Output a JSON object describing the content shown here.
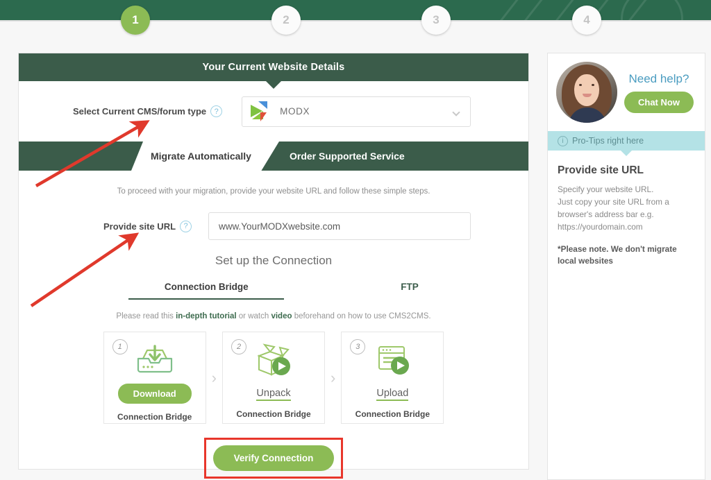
{
  "stepper": {
    "steps": [
      {
        "label": "1",
        "state": "active"
      },
      {
        "label": "2",
        "state": "idle"
      },
      {
        "label": "3",
        "state": "idle"
      },
      {
        "label": "4",
        "state": "idle"
      }
    ]
  },
  "main": {
    "header_title": "Your Current Website Details",
    "cms_field": {
      "label": "Select Current CMS/forum type",
      "help_icon": "question-icon",
      "selected": "MODX",
      "chevron": "chevron-down-icon"
    },
    "tabs": [
      {
        "label": "Migrate Automatically",
        "active": true
      },
      {
        "label": "Order Supported Service",
        "active": false
      }
    ],
    "intro_text": "To proceed with your migration, provide your website URL and follow these simple steps.",
    "url_field": {
      "label": "Provide site URL",
      "help_icon": "question-icon",
      "value": "www.YourMODXwebsite.com",
      "placeholder": "www.YourMODXwebsite.com"
    },
    "setup_title": "Set up the Connection",
    "connection_tabs": [
      {
        "label": "Connection Bridge",
        "active": true
      },
      {
        "label": "FTP",
        "active": false
      }
    ],
    "read_line": {
      "prefix": "Please read this ",
      "link1": "in-depth tutorial",
      "middle": " or watch ",
      "link2": "video",
      "suffix": " beforehand on how to use CMS2CMS."
    },
    "bridge_steps": [
      {
        "num": "1",
        "icon": "download-tray-icon",
        "action": "Download",
        "action_type": "pill",
        "caption": "Connection Bridge"
      },
      {
        "num": "2",
        "icon": "open-box-play-icon",
        "action": "Unpack",
        "action_type": "link",
        "caption": "Connection Bridge"
      },
      {
        "num": "3",
        "icon": "browser-window-play-icon",
        "action": "Upload",
        "action_type": "link",
        "caption": "Connection Bridge"
      }
    ],
    "step_separator": "›",
    "verify_button": "Verify Connection"
  },
  "sidebar": {
    "avatar": "support-agent-avatar",
    "need_help": "Need help?",
    "chat_button": "Chat Now",
    "protips_label": "Pro-Tips right here",
    "protips_icon": "info-icon",
    "tips_title": "Provide site URL",
    "tips_text": "Specify your website URL.\nJust copy your site URL from a\nbrowser's address bar e.g.\nhttps://yourdomain.com",
    "tips_note": "*Please note. We don't migrate local websites"
  },
  "colors": {
    "band_green": "#2c6a4e",
    "header_green": "#3b5c4a",
    "accent_green": "#8cbb55",
    "teal": "#b4e2e6",
    "link_blue": "#4a9cc0",
    "annotation_red": "#e8362b"
  }
}
